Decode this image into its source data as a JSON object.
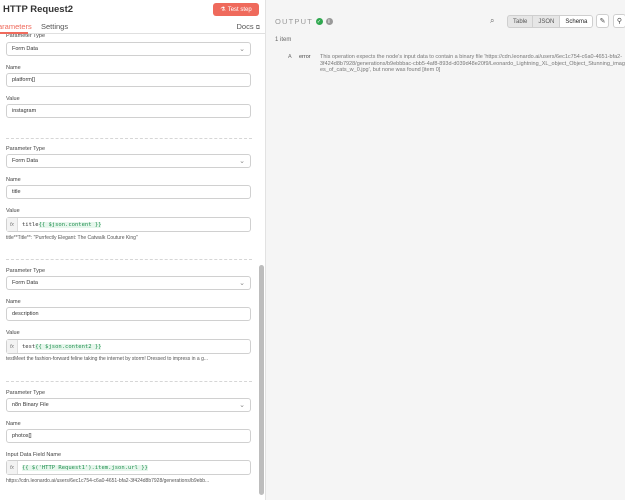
{
  "header": {
    "title": "HTTP Request2",
    "test_step_label": "Test step"
  },
  "tabs": {
    "parameters": "Parameters",
    "settings": "Settings",
    "docs": "Docs"
  },
  "form": {
    "p1_type_label": "Parameter Type",
    "p1_type_value": "Form Data",
    "p1_name_label": "Name",
    "p1_name_value": "platform[]",
    "p1_value_label": "Value",
    "p1_value_value": "instagram",
    "p2_type_label": "Parameter Type",
    "p2_type_value": "Form Data",
    "p2_name_label": "Name",
    "p2_name_value": "title",
    "p2_value_label": "Value",
    "p2_value_prefix": "title",
    "p2_value_token": "{{ $json.content }}",
    "p2_value_hint": "title**Title**: \"Purrfectly Elegant: The Catwalk Couture King\"",
    "p3_type_label": "Parameter Type",
    "p3_type_value": "Form Data",
    "p3_name_label": "Name",
    "p3_name_value": "description",
    "p3_value_label": "Value",
    "p3_value_prefix": "test",
    "p3_value_token": "{{ $json.content2 }}",
    "p3_value_hint": "testMeet the fashion-forward feline taking the internet by storm! Dressed to impress in a g...",
    "p4_type_label": "Parameter Type",
    "p4_type_value": "n8n Binary File",
    "p4_name_label": "Name",
    "p4_name_value": "photos[]",
    "p4_field_label": "Input Data Field Name",
    "p4_field_token": "{{ $('HTTP Request1').item.json.url }}",
    "p4_field_hint": "https://cdn.leonardo.ai/users/6ec1c754-c6a0-4651-bfa2-3f424d8b7928/generations/b9ebb..."
  },
  "output": {
    "title": "OUTPUT",
    "views": [
      "Table",
      "JSON",
      "Schema"
    ],
    "selected_view": "Schema",
    "item_count": "1 item",
    "row_key": "A",
    "row_field": "error",
    "row_message": "This operation expects the node's input data to contain a binary file 'https://cdn.leonardo.ai/users/6ec1c754-c6a0-4651-bfa2-3f424d8b7928/generations/b9ebbbac-cbb5-4af8-893d-d039d48e20f9/Leonardo_Lightning_XL_object_Object_Stunning_images_of_cats_w_0.jpg', but none was found [item 0]"
  },
  "colors": {
    "accent": "#ef6a5c",
    "success": "#2fa84f",
    "token": "#1f8f4e"
  }
}
